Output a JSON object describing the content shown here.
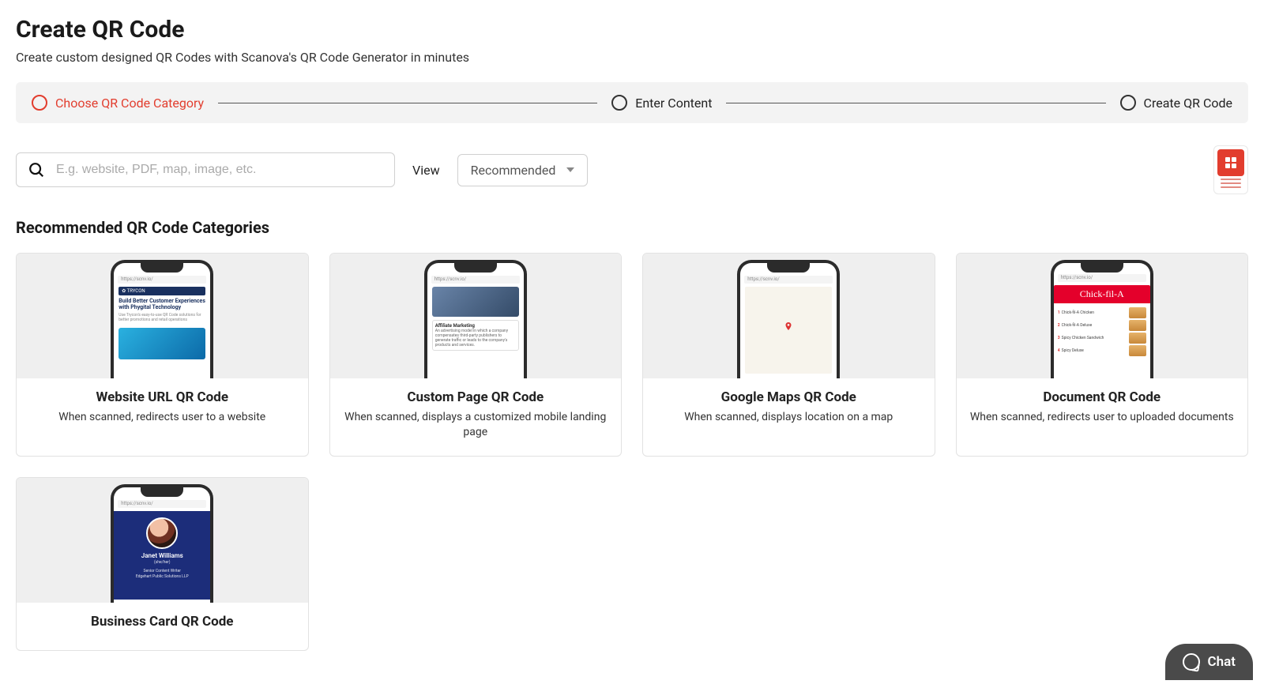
{
  "header": {
    "title": "Create QR Code",
    "subtitle": "Create custom designed QR Codes with Scanova's QR Code Generator in minutes"
  },
  "stepper": {
    "steps": [
      {
        "label": "Choose QR Code Category",
        "active": true
      },
      {
        "label": "Enter Content",
        "active": false
      },
      {
        "label": "Create QR Code",
        "active": false
      }
    ]
  },
  "search": {
    "placeholder": "E.g. website, PDF, map, image, etc."
  },
  "view": {
    "label": "View",
    "selected": "Recommended"
  },
  "section_title": "Recommended QR Code Categories",
  "cards": [
    {
      "title": "Website URL QR Code",
      "desc": "When scanned, redirects user to a website",
      "preview_url": "https://scnv.io/"
    },
    {
      "title": "Custom Page QR Code",
      "desc": "When scanned, displays a customized mobile landing page",
      "preview_url": "https://scnv.io/"
    },
    {
      "title": "Google Maps QR Code",
      "desc": "When scanned, displays location on a map",
      "preview_url": "https://scnv.io/"
    },
    {
      "title": "Document QR Code",
      "desc": "When scanned, redirects user to uploaded documents",
      "preview_url": "https://scnv.io/"
    },
    {
      "title": "Business Card QR Code",
      "desc": "",
      "preview_url": "https://scnv.io/"
    }
  ],
  "phone_previews": {
    "trycon": {
      "brand": "✿ TRYCON",
      "headline": "Build Better Customer Experiences with Phygital Technology"
    },
    "custom_page": {
      "card_title": "Affiliate Marketing"
    },
    "document": {
      "brand": "Chick-fil-A",
      "items": [
        "Chick-fil-A Chicken",
        "Chick-fil-A Deluxe",
        "Spicy Chicken Sandwich",
        "Spicy Deluxe"
      ]
    },
    "business_card": {
      "name": "Janet Williams",
      "handle": "(she/her)",
      "role": "Senior Content Writer",
      "company": "Edgehart Public Solutions LLP"
    }
  },
  "chat": {
    "label": "Chat"
  }
}
